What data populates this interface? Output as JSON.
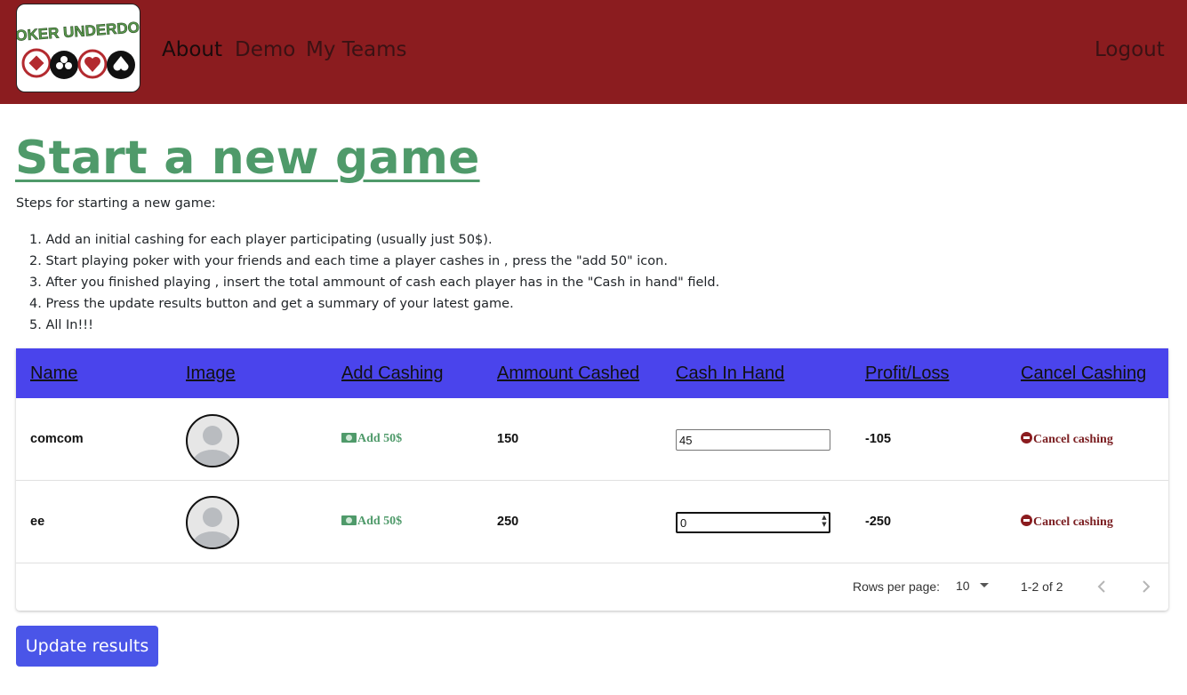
{
  "nav": {
    "logo_text": "POKER UNDERDOG",
    "links": [
      "About",
      "Demo",
      "My Teams"
    ],
    "logout": "Logout"
  },
  "page": {
    "title": "Start a new game",
    "intro": "Steps for starting a new game:",
    "steps": [
      "1. Add an initial cashing for each player participating (usually just 50$).",
      "2. Start playing poker with your friends and each time a player cashes in , press the \"add 50\" icon.",
      "3. After you finished playing , insert the total ammount of cash each player has in the \"Cash in hand\" field.",
      "4. Press the update results button and get a summary of your latest game.",
      "5. All In!!!"
    ]
  },
  "table": {
    "headers": [
      "Name",
      "Image",
      "Add Cashing",
      "Ammount Cashed",
      "Cash In Hand",
      "Profit/Loss",
      "Cancel Cashing"
    ],
    "rows": [
      {
        "name": "comcom",
        "add_label": "Add 50$",
        "amount_cashed": "150",
        "cash_in_hand": "45",
        "profit_loss": "-105",
        "cancel_label": "Cancel cashing"
      },
      {
        "name": "ee",
        "add_label": "Add 50$",
        "amount_cashed": "250",
        "cash_in_hand": "0",
        "profit_loss": "-250",
        "cancel_label": "Cancel cashing"
      }
    ],
    "pagination": {
      "rows_per_page_label": "Rows per page:",
      "rows_per_page": "10",
      "range": "1-2 of 2"
    }
  },
  "update_button": "Update results",
  "colors": {
    "navbar": "#8b1c1f",
    "title_green": "#4f9a6a",
    "table_header": "#4a44ec",
    "button": "#4a55e8"
  },
  "icons": [
    "logo-image",
    "money-icon",
    "cancel-icon",
    "avatar-placeholder",
    "chevron-left-icon",
    "chevron-right-icon",
    "caret-down-icon"
  ]
}
